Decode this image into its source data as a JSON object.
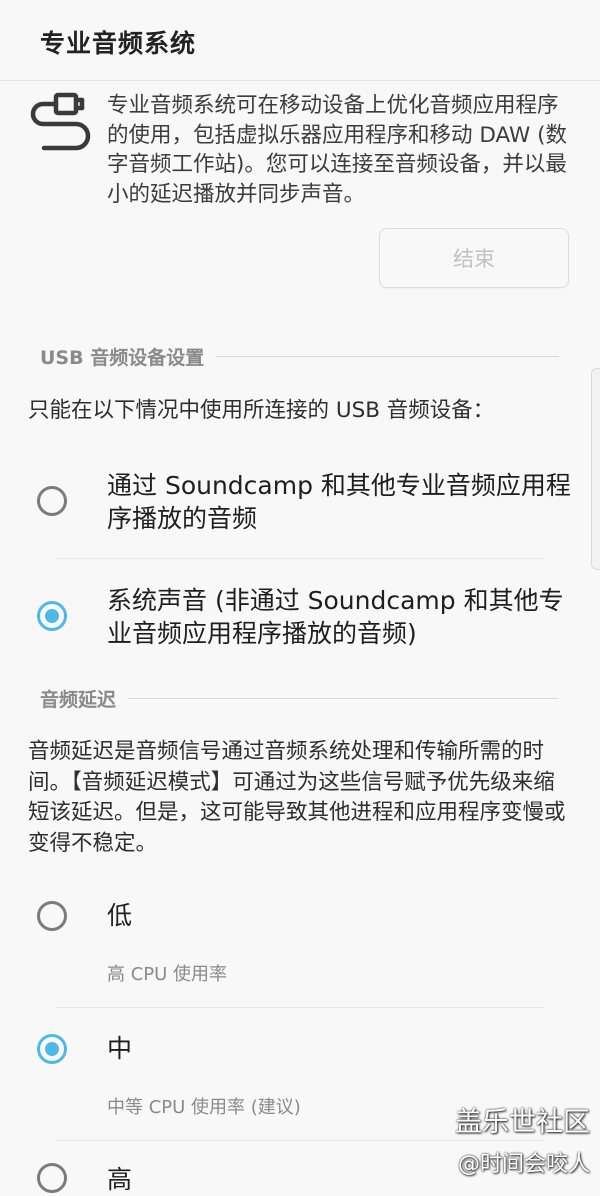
{
  "header": {
    "title": "专业音频系统"
  },
  "intro": {
    "icon": "audio-cable-icon",
    "text": "专业音频系统可在移动设备上优化音频应用程序的使用，包括虚拟乐器应用程序和移动 DAW (数字音频工作站)。您可以连接至音频设备，并以最小的延迟播放并同步声音。",
    "end_button": "结束"
  },
  "usb_section": {
    "header": "USB 音频设备设置",
    "description": "只能在以下情况中使用所连接的 USB 音频设备：",
    "options": [
      {
        "label": "通过 Soundcamp 和其他专业音频应用程序播放的音频",
        "selected": false
      },
      {
        "label": "系统声音 (非通过 Soundcamp 和其他专业音频应用程序播放的音频)",
        "selected": true
      }
    ]
  },
  "latency_section": {
    "header": "音频延迟",
    "description": "音频延迟是音频信号通过音频系统处理和传输所需的时间。【音频延迟模式】可通过为这些信号赋予优先级来缩短该延迟。但是，这可能导致其他进程和应用程序变慢或变得不稳定。",
    "options": [
      {
        "label": "低",
        "sublabel": "高 CPU 使用率",
        "selected": false
      },
      {
        "label": "中",
        "sublabel": "中等 CPU 使用率 (建议)",
        "selected": true
      },
      {
        "label": "高",
        "sublabel": "",
        "selected": false
      }
    ]
  },
  "watermark": {
    "line1": "盖乐世社区",
    "line2": "@时间会咬人"
  },
  "colors": {
    "accent": "#4fb8e3",
    "background": "#f8f8f8",
    "disabled_text": "#c2c2c2"
  }
}
